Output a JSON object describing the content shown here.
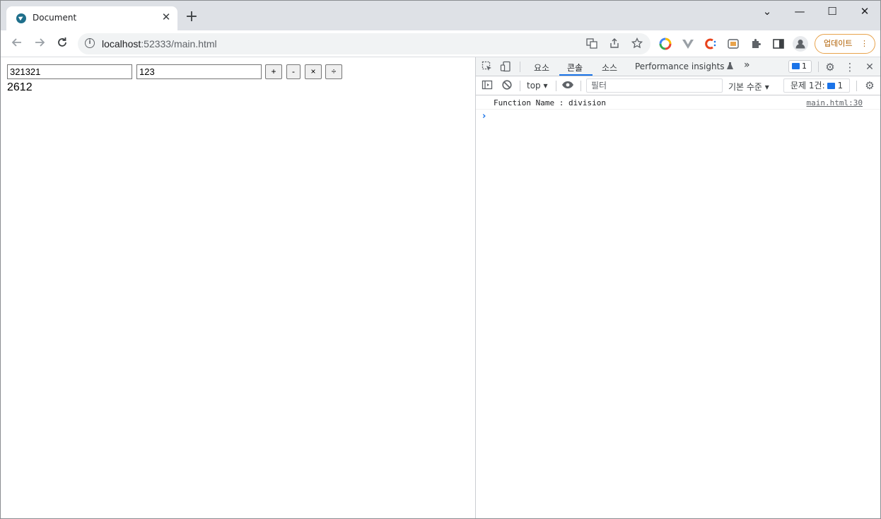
{
  "browser": {
    "tab": {
      "title": "Document",
      "close_glyph": "✕"
    },
    "new_tab_glyph": "+",
    "window_controls": {
      "menu": "⌄",
      "minimize": "—",
      "maximize": "☐",
      "close": "✕"
    },
    "address": {
      "host": "localhost",
      "rest": ":52333/main.html"
    },
    "update_button": "업데이트"
  },
  "page": {
    "input_a": "321321",
    "input_b": "123",
    "buttons": {
      "add": "+",
      "sub": "-",
      "mul": "×",
      "div": "÷"
    },
    "result": "2612"
  },
  "devtools": {
    "tabs": {
      "elements": "요소",
      "console": "콘솔",
      "sources": "소스",
      "performance": "Performance insights",
      "more": "»"
    },
    "badge_count": "1",
    "context": "top",
    "filter_placeholder": "필터",
    "levels": "기본 수준",
    "issues_label": "문제 1건:",
    "issues_count": "1",
    "log": {
      "message": "Function Name : division",
      "source": "main.html:30"
    },
    "prompt": "›"
  },
  "colors": {
    "accent": "#1a73e8",
    "update_border": "#e8a34c",
    "tabstrip": "#dee1e6"
  }
}
